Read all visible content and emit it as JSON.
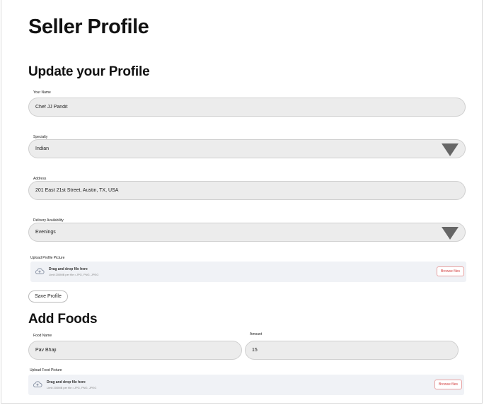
{
  "page": {
    "title": "Seller Profile"
  },
  "profile": {
    "heading": "Update your Profile",
    "name": {
      "label": "Your Name",
      "value": "Chef JJ Pandit"
    },
    "specialty": {
      "label": "Specialty",
      "value": "Indian"
    },
    "address": {
      "label": "Address",
      "value": "201 East 21st Street, Austin, TX, USA"
    },
    "delivery": {
      "label": "Delivery Availability",
      "value": "Evenings"
    },
    "picture": {
      "label": "Upload Profile Picture",
      "drop_text": "Drag and drop file here",
      "limit_text": "Limit 200MB per file • JPG, PNG, JPEG",
      "browse_label": "Browse files"
    },
    "save_label": "Save Profile"
  },
  "foods": {
    "heading": "Add Foods",
    "food_name": {
      "label": "Food Name",
      "value": "Pav Bhaji"
    },
    "amount": {
      "label": "Amount",
      "value": "15"
    },
    "picture": {
      "label": "Upload Food Picture",
      "drop_text": "Drag and drop file here",
      "limit_text": "Limit 200MB per file • JPG, PNG, JPEG",
      "browse_label": "Browse files"
    }
  },
  "colors": {
    "field_bg": "#ececec",
    "upload_bg": "#f0f2f6",
    "browse_accent": "#d34040"
  }
}
